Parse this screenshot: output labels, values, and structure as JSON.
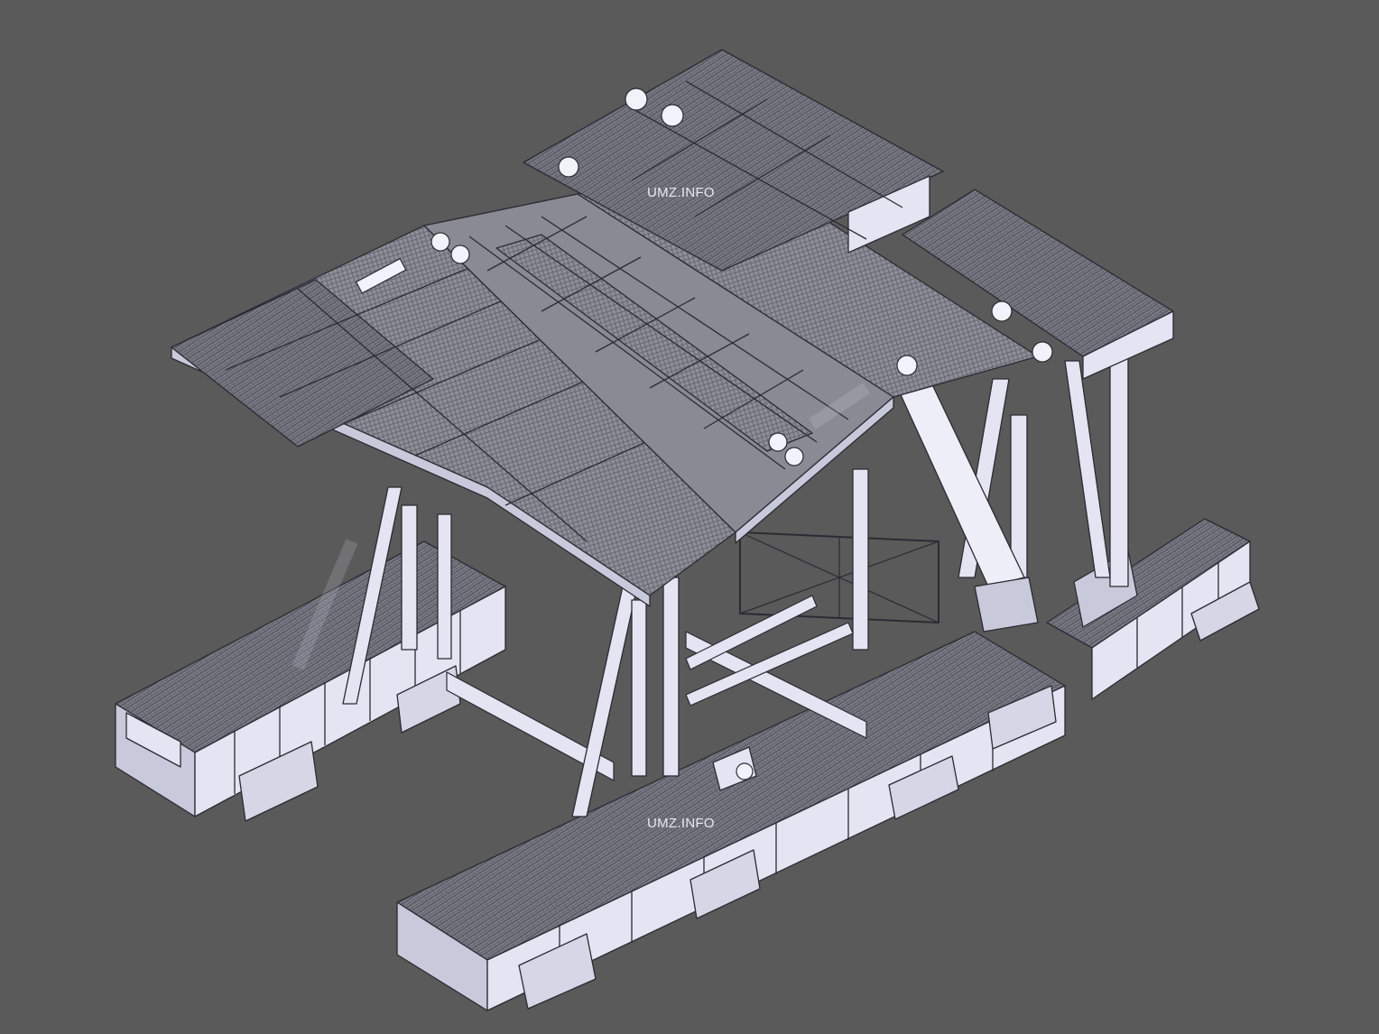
{
  "watermarks": {
    "top": "UMZ.INFO",
    "bottom": "UMZ.INFO"
  },
  "colors": {
    "background": "#5a5a5a",
    "plate": "#8e8e98",
    "plate_dark": "#6e6e78",
    "frame": "#e4e4f2",
    "frame_shade": "#c9c9dc",
    "edge": "#2b2b33"
  }
}
